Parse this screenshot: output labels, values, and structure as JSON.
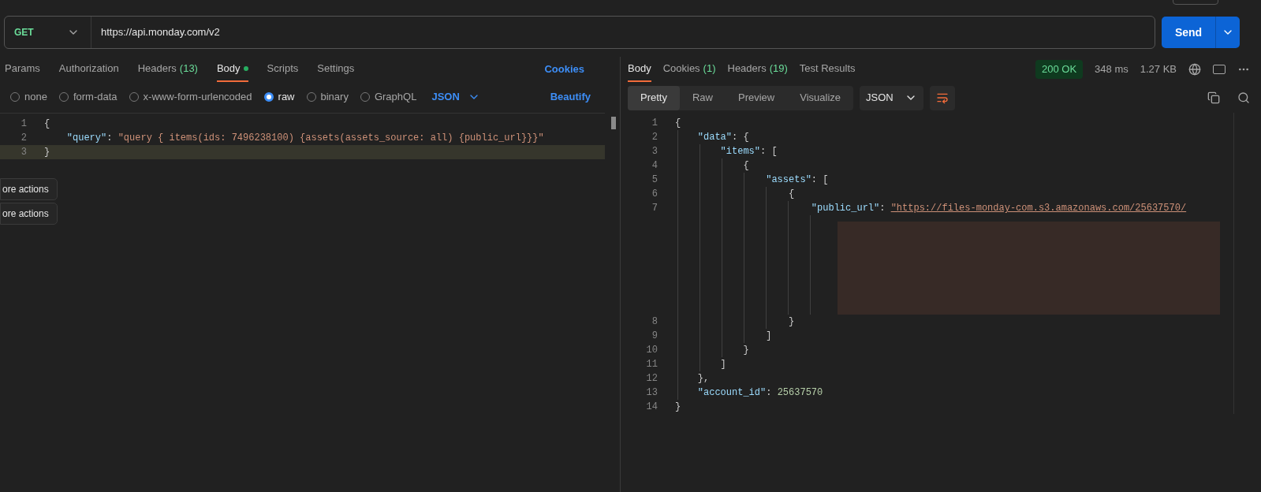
{
  "request": {
    "method": "GET",
    "url": "https://api.monday.com/v2",
    "send": "Send"
  },
  "request_tabs": [
    {
      "label": "Params",
      "selected": false
    },
    {
      "label": "Authorization",
      "selected": false
    },
    {
      "label": "Headers",
      "count": "(13)",
      "selected": false
    },
    {
      "label": "Body",
      "dot": true,
      "selected": true
    },
    {
      "label": "Scripts",
      "selected": false
    },
    {
      "label": "Settings",
      "selected": false
    }
  ],
  "cookies_link": "Cookies",
  "body_types": [
    {
      "label": "none",
      "selected": false
    },
    {
      "label": "form-data",
      "selected": false
    },
    {
      "label": "x-www-form-urlencoded",
      "selected": false
    },
    {
      "label": "raw",
      "selected": true
    },
    {
      "label": "binary",
      "selected": false
    },
    {
      "label": "GraphQL",
      "selected": false
    }
  ],
  "body_format": "JSON",
  "beautify": "Beautify",
  "request_editor": [
    {
      "number": "1",
      "tokens": [
        {
          "kind": "punct",
          "text": "{"
        }
      ],
      "current": false
    },
    {
      "number": "2",
      "tokens": [
        {
          "kind": "key",
          "text": "    \"query\""
        },
        {
          "kind": "punct",
          "text": ": "
        },
        {
          "kind": "string",
          "text": "\"query { items(ids: 7496238100) {assets(assets_source: all) {public_url}}}\""
        }
      ],
      "current": false
    },
    {
      "number": "3",
      "tokens": [
        {
          "kind": "punct",
          "text": "}"
        }
      ],
      "current": true
    }
  ],
  "tooltips": [
    "ore actions",
    "ore actions"
  ],
  "response_tabs": [
    {
      "label": "Body",
      "selected": true
    },
    {
      "label": "Cookies",
      "count": "(1)",
      "selected": false
    },
    {
      "label": "Headers",
      "count": "(19)",
      "selected": false
    },
    {
      "label": "Test Results",
      "selected": false
    }
  ],
  "status": {
    "code": "200 OK",
    "time": "348 ms",
    "size": "1.27 KB"
  },
  "view_modes": [
    {
      "label": "Pretty",
      "selected": true
    },
    {
      "label": "Raw",
      "selected": false
    },
    {
      "label": "Preview",
      "selected": false
    },
    {
      "label": "Visualize",
      "selected": false
    }
  ],
  "response_format": "JSON",
  "response_editor": [
    {
      "number": "1",
      "tokens": [
        {
          "kind": "punct",
          "text": "{"
        }
      ]
    },
    {
      "number": "2",
      "tokens": [
        {
          "kind": "key",
          "text": "    \"data\""
        },
        {
          "kind": "punct",
          "text": ": {"
        }
      ]
    },
    {
      "number": "3",
      "tokens": [
        {
          "kind": "key",
          "text": "        \"items\""
        },
        {
          "kind": "punct",
          "text": ": ["
        }
      ]
    },
    {
      "number": "4",
      "tokens": [
        {
          "kind": "punct",
          "text": "            {"
        }
      ]
    },
    {
      "number": "5",
      "tokens": [
        {
          "kind": "key",
          "text": "                \"assets\""
        },
        {
          "kind": "punct",
          "text": ": ["
        }
      ]
    },
    {
      "number": "6",
      "tokens": [
        {
          "kind": "punct",
          "text": "                    {"
        }
      ]
    },
    {
      "number": "7",
      "tokens": [
        {
          "kind": "key",
          "text": "                        \"public_url\""
        },
        {
          "kind": "punct",
          "text": ": "
        },
        {
          "kind": "link",
          "text": "\"https://files-monday-com.s3.amazonaws.com/25637570/"
        }
      ],
      "redacted": true
    },
    {
      "number": "8",
      "tokens": [
        {
          "kind": "punct",
          "text": "                    }"
        }
      ]
    },
    {
      "number": "9",
      "tokens": [
        {
          "kind": "punct",
          "text": "                ]"
        }
      ]
    },
    {
      "number": "10",
      "tokens": [
        {
          "kind": "punct",
          "text": "            }"
        }
      ]
    },
    {
      "number": "11",
      "tokens": [
        {
          "kind": "punct",
          "text": "        ]"
        }
      ]
    },
    {
      "number": "12",
      "tokens": [
        {
          "kind": "punct",
          "text": "    },"
        }
      ]
    },
    {
      "number": "13",
      "tokens": [
        {
          "kind": "key",
          "text": "    \"account_id\""
        },
        {
          "kind": "punct",
          "text": ": "
        },
        {
          "kind": "number",
          "text": "25637570"
        }
      ]
    },
    {
      "number": "14",
      "tokens": [
        {
          "kind": "punct",
          "text": "}"
        }
      ]
    }
  ]
}
